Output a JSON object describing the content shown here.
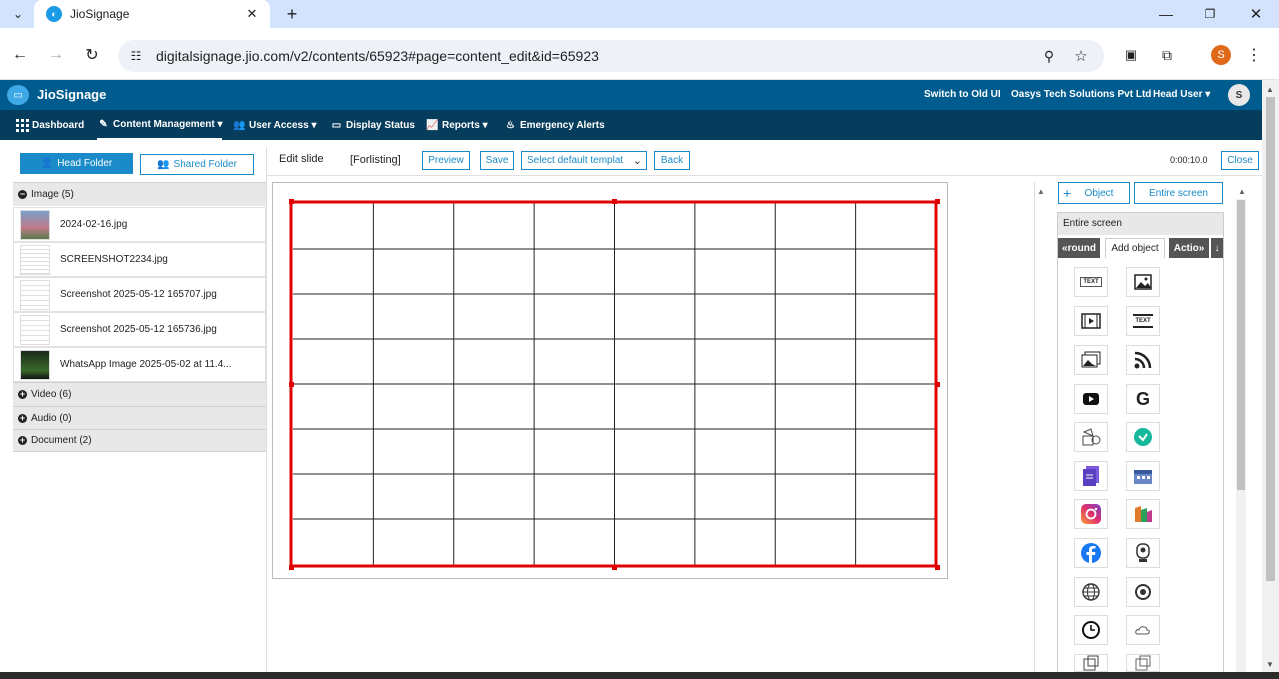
{
  "browser": {
    "tab_title": "JioSignage",
    "url": "digitalsignage.jio.com/v2/contents/65923#page=content_edit&id=65923",
    "profile_initial": "S"
  },
  "app": {
    "logo_text": "JioSignage",
    "switch_ui": "Switch to Old UI",
    "company": "Oasys Tech Solutions Pvt Ltd",
    "user_role": "Head User",
    "avatar_initial": "S"
  },
  "nav": {
    "items": [
      {
        "label": "Dashboard",
        "icon": "grid-icon",
        "dropdown": false
      },
      {
        "label": "Content Management",
        "icon": "edit-icon",
        "dropdown": true
      },
      {
        "label": "User Access",
        "icon": "users-icon",
        "dropdown": true
      },
      {
        "label": "Display Status",
        "icon": "monitor-icon",
        "dropdown": false
      },
      {
        "label": "Reports",
        "icon": "chart-icon",
        "dropdown": true
      },
      {
        "label": "Emergency Alerts",
        "icon": "alert-icon",
        "dropdown": false
      }
    ]
  },
  "left": {
    "head_folder": "Head Folder",
    "shared_folder": "Shared Folder",
    "image_folder": "Image (5)",
    "files": [
      "2024-02-16.jpg",
      "SCREENSHOT2234.jpg",
      "Screenshot 2025-05-12 165707.jpg",
      "Screenshot 2025-05-12 165736.jpg",
      "WhatsApp Image 2025-05-02 at 11.4..."
    ],
    "video_folder": "Video (6)",
    "audio_folder": "Audio (0)",
    "document_folder": "Document (2)"
  },
  "editor": {
    "title": "Edit slide",
    "slide_name": "[Forlisting]",
    "preview": "Preview",
    "save": "Save",
    "template_select": "Select default templat",
    "back": "Back",
    "duration": "0:00:10.0",
    "close": "Close"
  },
  "right": {
    "object_btn": "Object",
    "entire_screen_btn": "Entire screen",
    "panel_title": "Entire screen",
    "tab_left": "round",
    "tab_active": "Add object",
    "tab_right": "Actio",
    "tools": [
      "text-icon",
      "image-icon",
      "video-icon",
      "ticker-icon",
      "gallery-icon",
      "rss-icon",
      "youtube-icon",
      "google-icon",
      "shapes-icon",
      "app-icon",
      "document-icon",
      "calendar-icon",
      "instagram-icon",
      "gallery-app-icon",
      "facebook-icon",
      "webcam-icon",
      "web-icon",
      "record-icon",
      "clock-icon",
      "weather-icon",
      "widget-icon",
      "widget2-icon"
    ],
    "text_tool_label": "TEXT",
    "ticker_tool_label": "TEXT"
  },
  "colors": {
    "appbar": "#005b8f",
    "navbar": "#063c5c",
    "accent": "#1a8bc8",
    "selection": "#e00000"
  }
}
